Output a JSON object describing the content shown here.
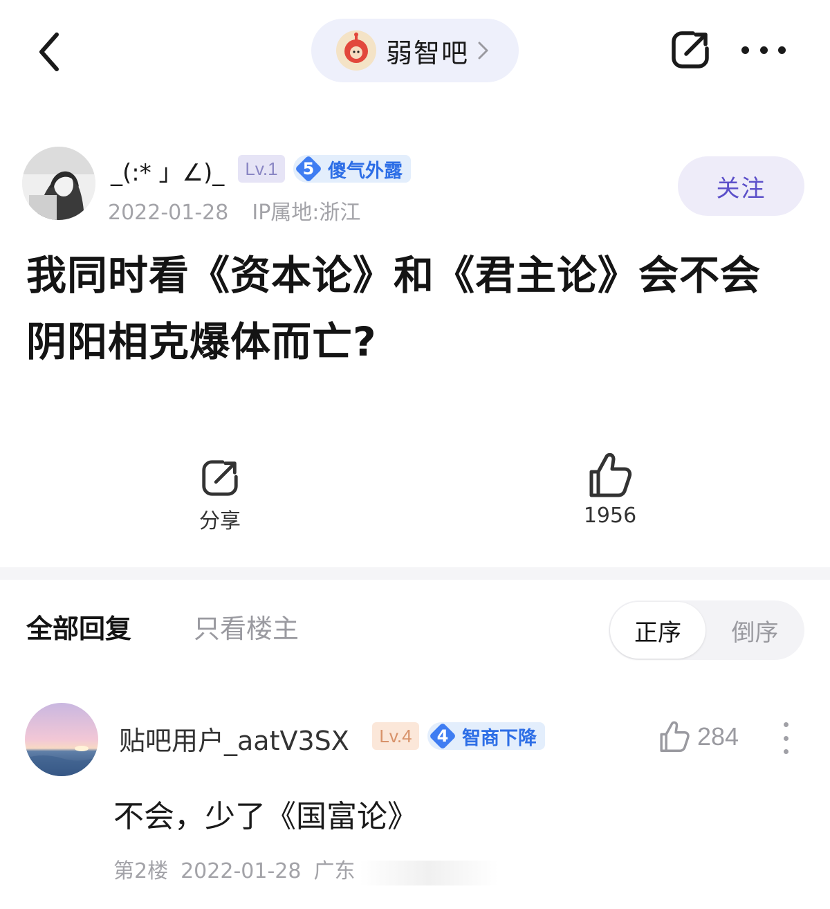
{
  "header": {
    "forum_name": "弱智吧",
    "icons": {
      "back": "chevron-left-icon",
      "share": "share-icon",
      "more": "more-horizontal-icon",
      "forum_arrow": "chevron-right-icon"
    }
  },
  "post": {
    "author": {
      "name": "_(:* 」∠)_",
      "level": "Lv.1",
      "title_level": "5",
      "title_text": "傻气外露",
      "date": "2022-01-28",
      "ip_location": "IP属地:浙江"
    },
    "follow_label": "关注",
    "title": "我同时看《资本论》和《君主论》会不会阴阳相克爆体而亡?",
    "share_label": "分享",
    "like_count": "1956"
  },
  "replies_section": {
    "tab_all": "全部回复",
    "tab_op_only": "只看楼主",
    "sort_asc": "正序",
    "sort_desc": "倒序"
  },
  "replies": [
    {
      "user": "贴吧用户_aatV3SX",
      "level": "Lv.4",
      "title_level": "4",
      "title_text": "智商下降",
      "likes": "284",
      "content": "不会，少了《国富论》",
      "floor": "第2楼",
      "date": "2022-01-28",
      "location": "广东"
    }
  ],
  "colors": {
    "accent_purple": "#5b4fc9",
    "title_badge_blue": "#3f7df2",
    "muted_text": "#a3a3a8"
  }
}
